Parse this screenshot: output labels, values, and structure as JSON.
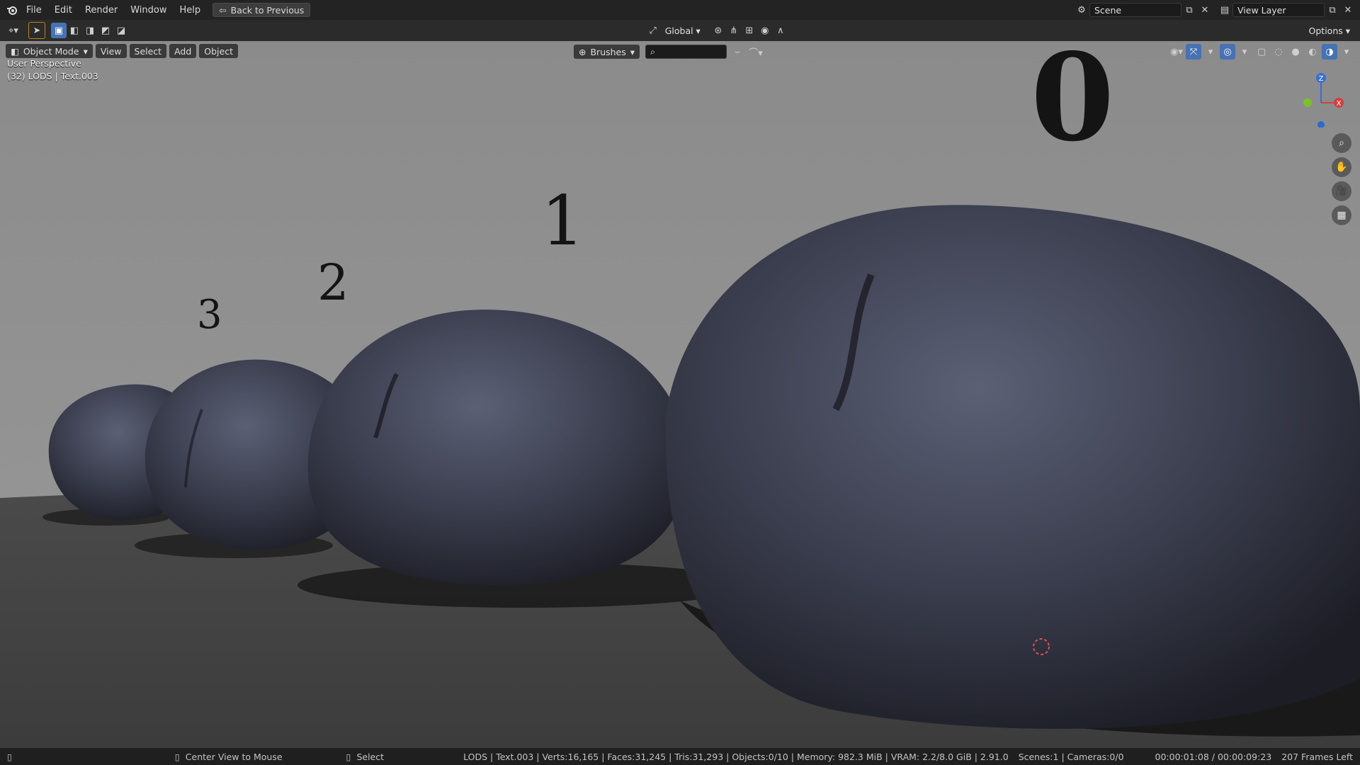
{
  "app": {
    "name": "Blender"
  },
  "menu": {
    "items": [
      "File",
      "Edit",
      "Render",
      "Window",
      "Help"
    ],
    "back_button": "Back to Previous"
  },
  "scene": {
    "label": "Scene",
    "view_layer": "View Layer"
  },
  "toolbar": {
    "orientation": "Global",
    "options": "Options"
  },
  "header": {
    "mode": "Object Mode",
    "menus": [
      "View",
      "Select",
      "Add",
      "Object"
    ],
    "brushes": "Brushes"
  },
  "viewport": {
    "perspective": "User Perspective",
    "active_object": "(32) LODS | Text.003",
    "lod_labels": [
      "0",
      "1",
      "2",
      "3"
    ]
  },
  "gizmo": {
    "z": "Z",
    "x": "X"
  },
  "status": {
    "left_hint": "Center View to Mouse",
    "mid_hint": "Select",
    "stats": "LODS | Text.003 | Verts:16,165 | Faces:31,245 | Tris:31,293 | Objects:0/10 | Memory: 982.3 MiB | VRAM: 2.2/8.0 GiB | 2.91.0",
    "scenes": "Scenes:1 | Cameras:0/0",
    "time": "00:00:01:08 / 00:00:09:23",
    "frames_left": "207 Frames Left"
  },
  "colors": {
    "accent": "#4772b3",
    "topbar": "#232323",
    "viewport_bg": "#8d8d8d",
    "rock": "#3b3f52"
  }
}
